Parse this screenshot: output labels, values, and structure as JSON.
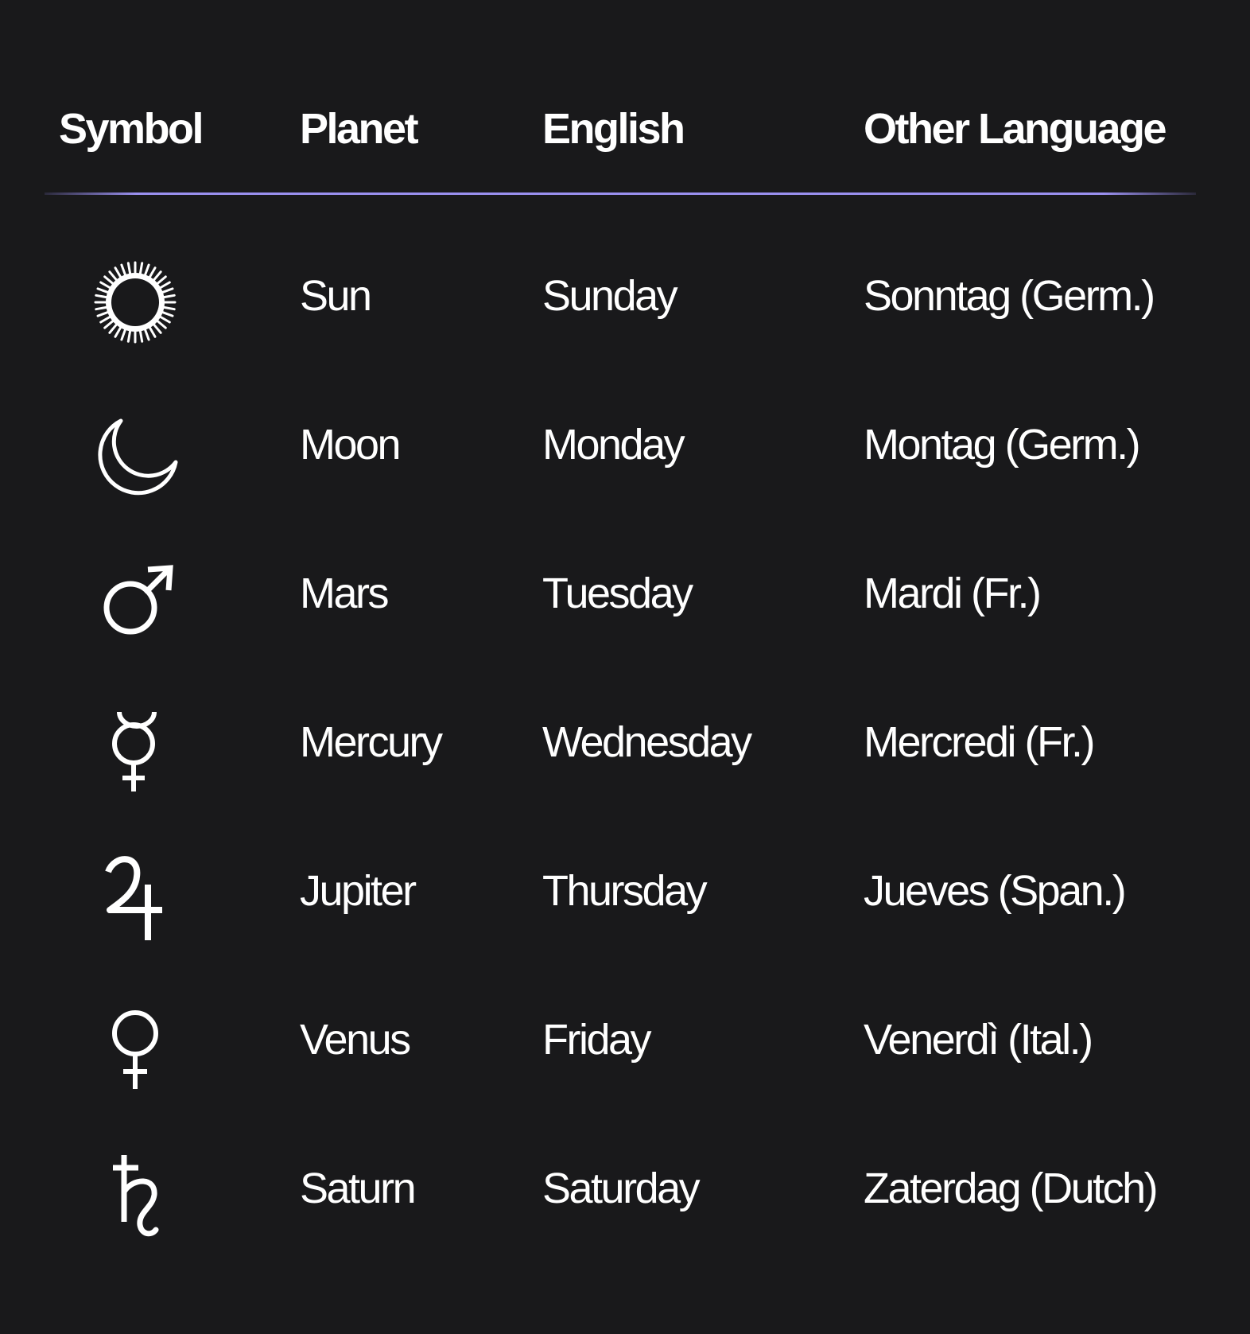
{
  "header": {
    "symbol": "Symbol",
    "planet": "Planet",
    "english": "English",
    "other": "Other Language"
  },
  "rows": [
    {
      "icon": "sun-icon",
      "planet": "Sun",
      "english": "Sunday",
      "other": "Sonntag (Germ.)"
    },
    {
      "icon": "moon-icon",
      "planet": "Moon",
      "english": "Monday",
      "other": "Montag (Germ.)"
    },
    {
      "icon": "mars-icon",
      "planet": "Mars",
      "english": "Tuesday",
      "other": "Mardi (Fr.)"
    },
    {
      "icon": "mercury-icon",
      "planet": "Mercury",
      "english": "Wednesday",
      "other": "Mercredi (Fr.)"
    },
    {
      "icon": "jupiter-icon",
      "planet": "Jupiter",
      "english": "Thursday",
      "other": "Jueves (Span.)"
    },
    {
      "icon": "venus-icon",
      "planet": "Venus",
      "english": "Friday",
      "other": "Venerdì (Ital.)"
    },
    {
      "icon": "saturn-icon",
      "planet": "Saturn",
      "english": "Saturday",
      "other": "Zaterdag (Dutch)"
    }
  ],
  "colors": {
    "background": "#19191b",
    "text": "#ffffff",
    "divider": "#9a90f0"
  }
}
